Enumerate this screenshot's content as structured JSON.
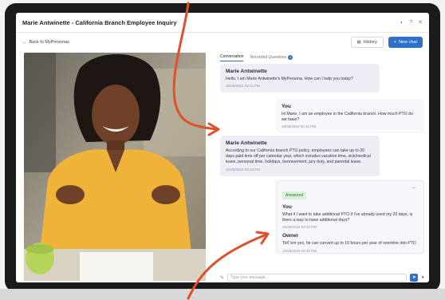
{
  "window": {
    "title": "Marie Antwinette - California Branch Employee Inquiry",
    "controls": [
      "settings-icon",
      "help-icon",
      "close-icon"
    ]
  },
  "subbar": {
    "back_label": "Back to MyPersonas",
    "history_label": "History",
    "new_chat_label": "New chat"
  },
  "tabs": [
    {
      "label": "Conversation",
      "active": true
    },
    {
      "label": "Recorded Questions",
      "badge": "1",
      "active": false
    }
  ],
  "messages": [
    {
      "author": "Marie Antwinette",
      "text": "Hello, I am Marie Antwinette's MyPersona. How can I help you today?",
      "time": "10/25/2024 02:41 PM",
      "role": "owner"
    },
    {
      "author": "You",
      "text": "Hi Marie, I am an employee in the California branch. How much PTO do we have?",
      "time": "10/25/2024 02:41 PM",
      "role": "you"
    },
    {
      "author": "Marie Antwinette",
      "text": "According to our California branch PTO policy, employees can take up to 20 days paid time off per calendar year, which includes vacation time, sick/medical leave, personal time, holidays, bereavement, jury duty, and parental leave.",
      "time": "10/25/2024 02:43 PM",
      "role": "owner"
    }
  ],
  "answered_card": {
    "badge": "Answered",
    "question_author": "You",
    "question_text": "What if I want to take additional PTO if I've already used my 20 days, is there a way to have additional days?",
    "question_time": "10/25/2024 02:45 PM",
    "answer_author": "Owner",
    "answer_text": "Tell 'em yes, he can convert up to 10 hours per year of overtime into PTO",
    "answer_time": "10/25/2024 02:46 PM"
  },
  "input": {
    "placeholder": "Type your message..."
  },
  "colors": {
    "accent": "#2d72c8",
    "answered_badge": "#d9efd9",
    "annotation_arrow": "#e0502a"
  }
}
